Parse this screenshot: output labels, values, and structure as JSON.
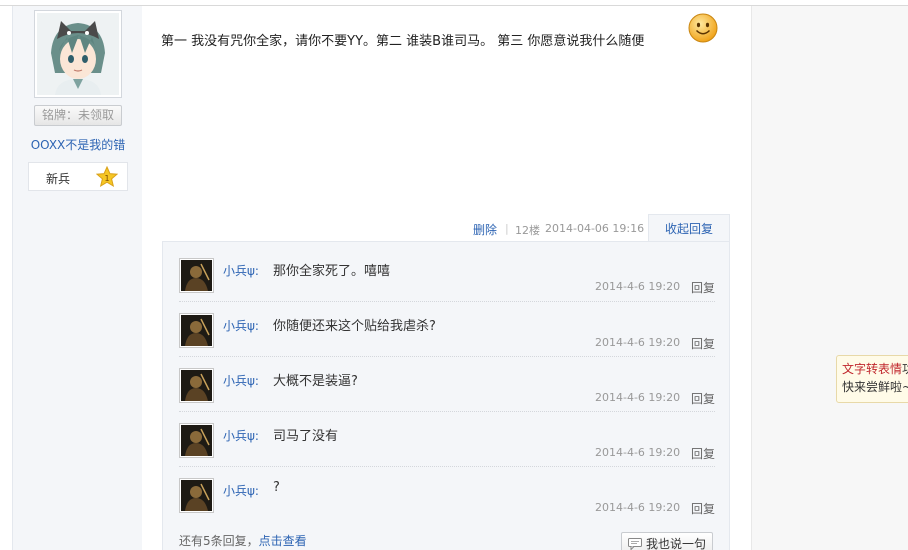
{
  "author": {
    "badge_label": "铭牌：未领取",
    "name": "OOXX不是我的错",
    "level_name": "新兵",
    "level_number": "1"
  },
  "post": {
    "content": "第一 我没有咒你全家，请你不要YY。第二 谁装B谁司马。 第三 你愿意说我什么随便",
    "delete_label": "删除",
    "separator": "|",
    "floor": "12楼",
    "time": "2014-04-06 19:16",
    "collapse_label": "收起回复"
  },
  "replies": [
    {
      "user": "小兵ψ:",
      "text": "那你全家死了。嘻嘻",
      "time": "2014-4-6 19:20",
      "reply_label": "回复"
    },
    {
      "user": "小兵ψ:",
      "text": "你随便还来这个贴给我虐杀?",
      "time": "2014-4-6 19:20",
      "reply_label": "回复"
    },
    {
      "user": "小兵ψ:",
      "text": "大概不是装逼?",
      "time": "2014-4-6 19:20",
      "reply_label": "回复"
    },
    {
      "user": "小兵ψ:",
      "text": "司马了没有",
      "time": "2014-4-6 19:20",
      "reply_label": "回复"
    },
    {
      "user": "小兵ψ:",
      "text": "?",
      "time": "2014-4-6 19:20",
      "reply_label": "回复"
    }
  ],
  "more": {
    "prefix": "还有5条回复，",
    "link_label": "点击查看",
    "say_button": "我也说一句"
  },
  "tip": {
    "line1_red": "文字转表情",
    "line1_rest": "功",
    "line2": "快来尝鲜啦~"
  },
  "colors": {
    "link": "#2d64b3",
    "panel_bg": "#f4f6f9",
    "tip_bg": "#fffbe8",
    "tip_red": "#c0272d"
  }
}
